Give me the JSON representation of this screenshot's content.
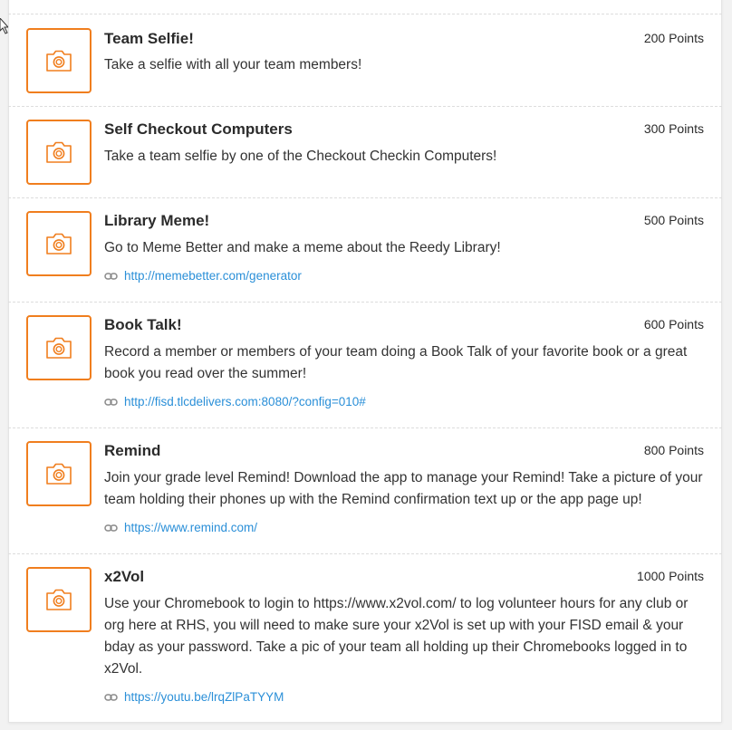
{
  "colors": {
    "accent": "#f07e1e",
    "link": "#2a8fd8",
    "divider": "#dddddd"
  },
  "items": [
    {
      "title": "Team Selfie!",
      "points": "200 Points",
      "description": "Take a selfie with all your team members!",
      "icon": "camera-icon"
    },
    {
      "title": "Self Checkout Computers",
      "points": "300 Points",
      "description": "Take a team selfie by one of the Checkout Checkin Computers!",
      "icon": "camera-icon"
    },
    {
      "title": "Library Meme!",
      "points": "500 Points",
      "description": "Go to Meme Better and make a meme about the Reedy Library!",
      "link": "http://memebetter.com/generator",
      "icon": "camera-icon"
    },
    {
      "title": "Book Talk!",
      "points": "600 Points",
      "description": "Record a member or members of your team doing a Book Talk of your favorite book or a great book you read over the summer!",
      "link": "http://fisd.tlcdelivers.com:8080/?config=010#",
      "icon": "camera-icon"
    },
    {
      "title": "Remind",
      "points": "800 Points",
      "description": "Join your grade level Remind! Download the app to manage your Remind! Take a picture of your team holding their phones up with the Remind confirmation text up or the app page up!",
      "link": "https://www.remind.com/",
      "icon": "camera-icon"
    },
    {
      "title": "x2Vol",
      "points": "1000 Points",
      "description": "Use your Chromebook to login to https://www.x2vol.com/ to log volunteer hours for any club or org here at RHS, you will need to make sure your x2Vol is set up with your FISD email & your bday as your password. Take a pic of your team all holding up their Chromebooks logged in to x2Vol.",
      "link": "https://youtu.be/lrqZlPaTYYM",
      "icon": "camera-icon"
    }
  ]
}
